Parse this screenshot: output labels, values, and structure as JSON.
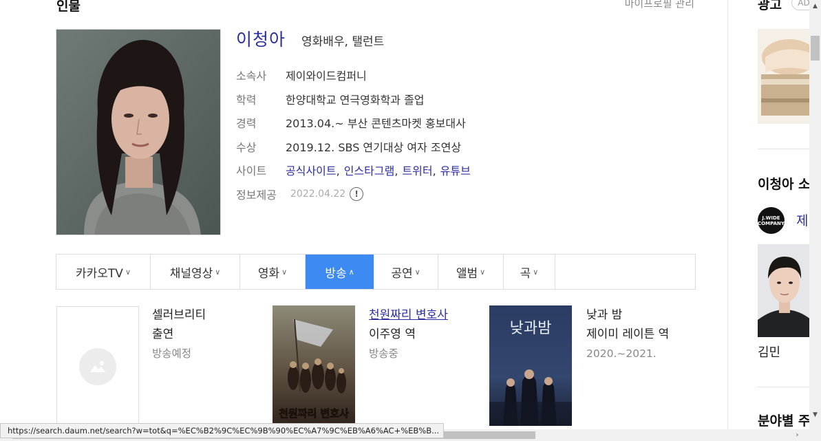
{
  "section": {
    "title": "인물",
    "manage_link": "마이프로필 관리"
  },
  "person": {
    "name": "이청아",
    "job": "영화배우, 탤런트",
    "rows": [
      {
        "label": "소속사",
        "value": "제이와이드컴퍼니"
      },
      {
        "label": "학력",
        "value": "한양대학교 연극영화학과 졸업"
      },
      {
        "label": "경력",
        "value": "2013.04.~ 부산 콘텐츠마켓 홍보대사"
      },
      {
        "label": "수상",
        "value": "2019.12. SBS 연기대상 여자 조연상"
      }
    ],
    "site": {
      "label": "사이트",
      "links": [
        "공식사이트",
        "인스타그램",
        "트위터",
        "유튜브"
      ]
    },
    "provide": {
      "label": "정보제공",
      "date": "2022.04.22",
      "icon": "exclamation-circle-icon"
    }
  },
  "tabs": [
    {
      "label": "카카오TV",
      "chevron": "∨"
    },
    {
      "label": "채널영상",
      "chevron": "∨"
    },
    {
      "label": "영화",
      "chevron": "∨"
    },
    {
      "label": "방송",
      "chevron": "∧"
    },
    {
      "label": "공연",
      "chevron": "∨"
    },
    {
      "label": "앨범",
      "chevron": "∨"
    },
    {
      "label": "곡",
      "chevron": "∨"
    }
  ],
  "active_tab": "방송",
  "works": [
    {
      "title": "셀러브리티",
      "role": "출연",
      "status": "방송예정"
    },
    {
      "title": "천원짜리 변호사",
      "role": "이주영 역",
      "status": "방송중",
      "poster_text": "천원짜리 변호사"
    },
    {
      "title": "낮과 밤",
      "role": "제이미 레이튼 역",
      "status": "2020.~2021.",
      "poster_text": "낮과밤"
    }
  ],
  "sidebar": {
    "ad_title": "광고",
    "ad_badge": "AD",
    "related_title": "이청아 소",
    "agency_logo": "J.WIDE COMPANY",
    "agency_name": "제",
    "related_person": "김민",
    "next_section": "분야별 주"
  },
  "status_url": "https://search.daum.net/search?w=tot&q=%EC%B2%9C%EC%9B%90%EC%A7%9C%EB%A6%AC+%EB%B..."
}
